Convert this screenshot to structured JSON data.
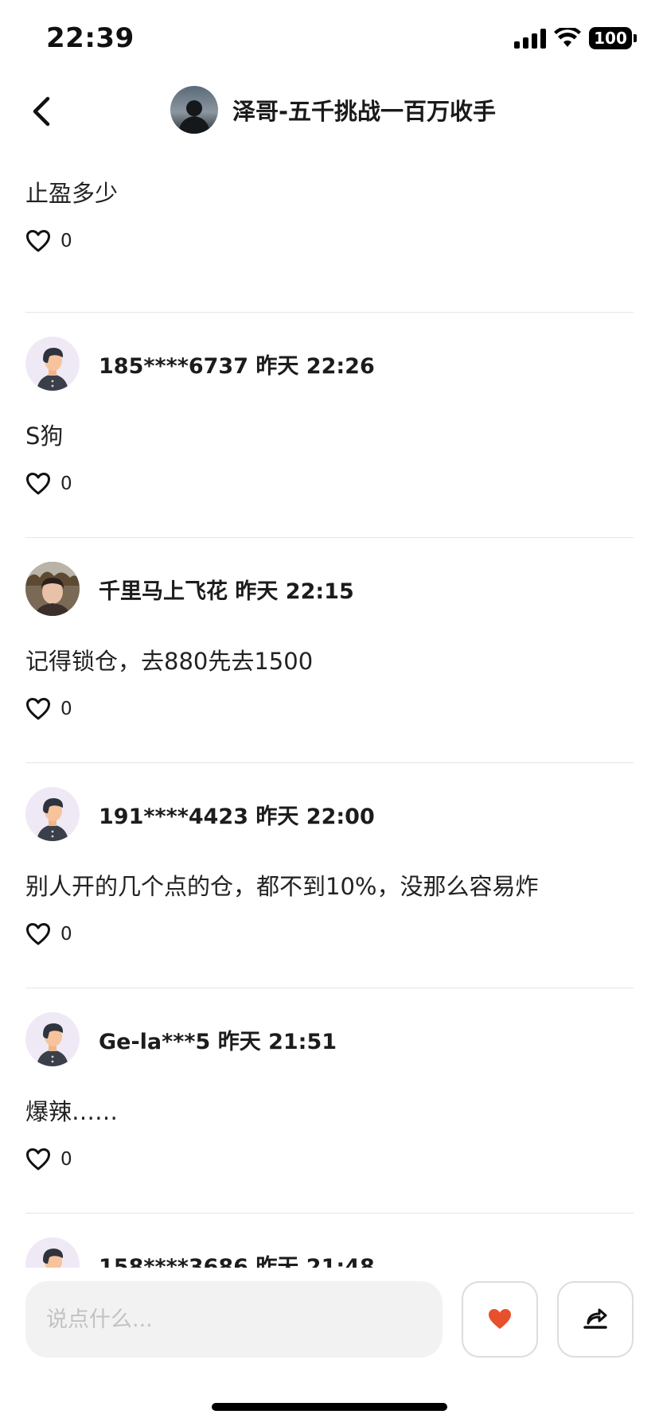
{
  "status_bar": {
    "time": "22:39",
    "battery": "100"
  },
  "header": {
    "title": "泽哥-五千挑战一百万收手"
  },
  "comments": [
    {
      "meta": "",
      "text": "止盈多少",
      "likes": "0",
      "avatar": "default-avatar"
    },
    {
      "meta": "185****6737 昨天 22:26",
      "text": "S狗",
      "likes": "0",
      "avatar": "default-avatar"
    },
    {
      "meta": "千里马上飞花 昨天 22:15",
      "text": "记得锁仓，去880先去1500",
      "likes": "0",
      "avatar": "photo-avatar"
    },
    {
      "meta": "191****4423 昨天 22:00",
      "text": "别人开的几个点的仓，都不到10%，没那么容易炸",
      "likes": "0",
      "avatar": "default-avatar"
    },
    {
      "meta": "Ge-la***5 昨天 21:51",
      "text": "爆辣……",
      "likes": "0",
      "avatar": "default-avatar"
    },
    {
      "meta": "158****3686 昨天 21:48",
      "text": "",
      "likes": "",
      "avatar": "default-avatar"
    }
  ],
  "composer": {
    "placeholder": "说点什么..."
  },
  "colors": {
    "like_active": "#e8502d",
    "divider": "#e6e6e6",
    "input_bg": "#f2f2f2"
  },
  "icons": {
    "back": "chevron-left-icon",
    "like": "heart-outline-icon",
    "like_button": "heart-filled-icon",
    "share": "share-icon"
  }
}
